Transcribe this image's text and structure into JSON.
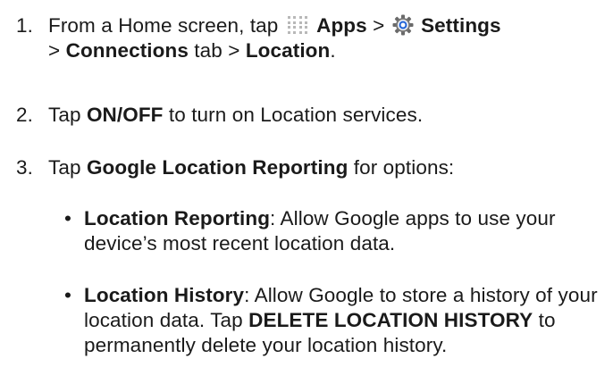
{
  "steps": [
    {
      "number": "1.",
      "t1": "From a Home screen, tap ",
      "apps_label": "Apps",
      "sep1": " > ",
      "settings_label": "Settings",
      "sep2": "> ",
      "connections_label": "Connections",
      "t2": " tab > ",
      "location_label": "Location",
      "t3": "."
    },
    {
      "number": "2.",
      "t1": "Tap ",
      "onoff_label": "ON/OFF",
      "t2": " to turn on Location services."
    },
    {
      "number": "3.",
      "t1": "Tap ",
      "glr_label": "Google Location Reporting",
      "t2": " for options:"
    }
  ],
  "bullets": [
    {
      "dot": "•",
      "term": "Location Reporting",
      "text": ": Allow Google apps to use your device’s most recent location data."
    },
    {
      "dot": "•",
      "term": "Location History",
      "t1": ": Allow Google to store a history of your location data. Tap ",
      "action": "DELETE LOCATION HISTORY",
      "t2": " to permanently delete your location history."
    }
  ],
  "icons": {
    "apps": "apps-grid-icon",
    "settings": "gear-icon",
    "accent": "#2a6ad8"
  }
}
